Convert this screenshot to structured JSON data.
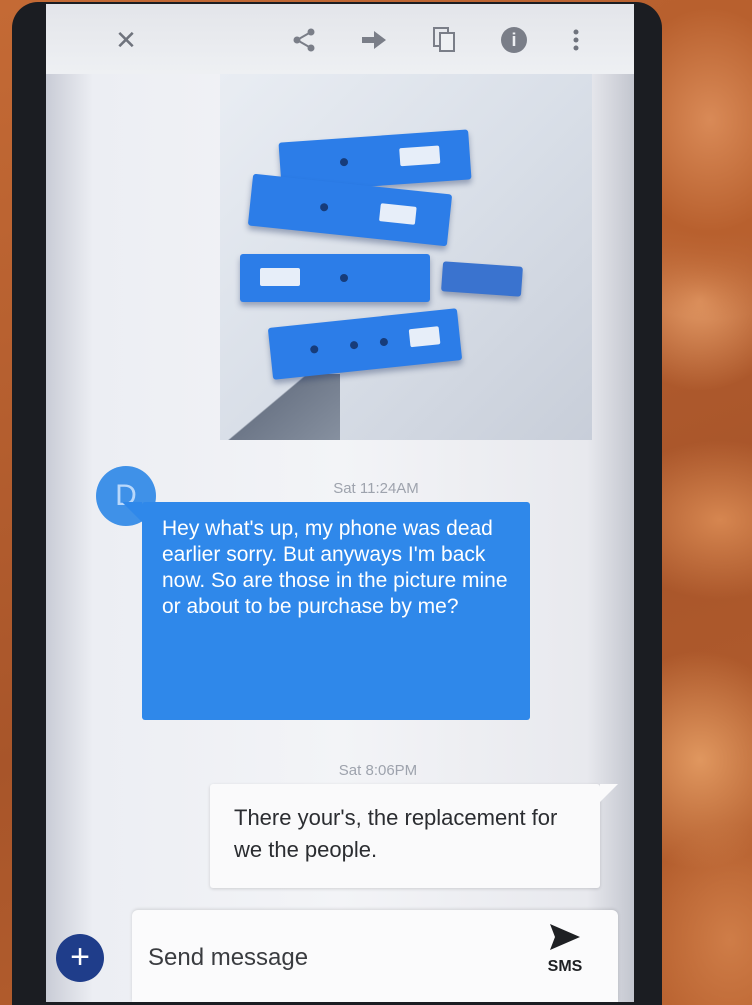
{
  "toolbar": {
    "close_icon": "close-icon",
    "share_icon": "share-icon",
    "forward_icon": "forward-icon",
    "copy_icon": "copy-icon",
    "info_icon": "info-icon",
    "more_icon": "more-vert-icon"
  },
  "messages": [
    {
      "timestamp": "Sat 11:24AM",
      "direction": "incoming",
      "avatar_letter": "D",
      "text": "Hey what's up,  my phone was dead earlier sorry.  But anyways I'm back now.  So are those in the picture mine or about to be purchase by me?"
    },
    {
      "timestamp": "Sat 8:06PM",
      "direction": "outgoing",
      "text": "There your's, the replacement for we the people."
    }
  ],
  "composer": {
    "placeholder": "Send message",
    "send_label": "SMS"
  },
  "colors": {
    "incoming_bubble": "#2f88ea",
    "outgoing_bubble": "#fafafb",
    "add_button": "#1f3d8a"
  }
}
